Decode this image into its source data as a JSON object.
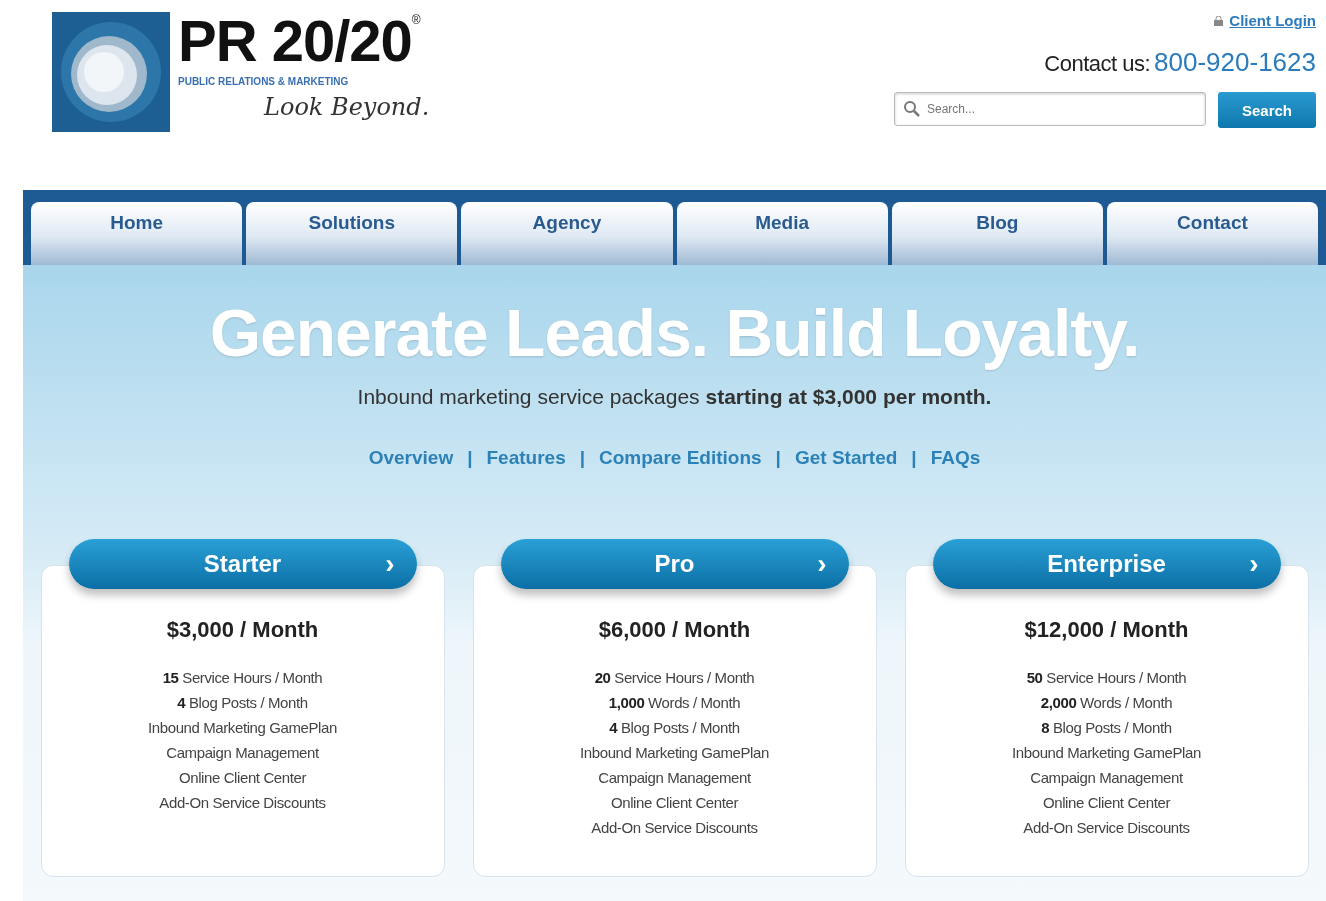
{
  "logo": {
    "name": "PR 20/20",
    "mark": "®",
    "subtitle": "PUBLIC RELATIONS & MARKETING",
    "tagline": "Look Beyond."
  },
  "header": {
    "login": "Client Login",
    "contact_label": "Contact us:",
    "phone": "800-920-1623",
    "search": {
      "placeholder": "Search..."
    },
    "search_button": "Search"
  },
  "nav": [
    {
      "label": "Home"
    },
    {
      "label": "Solutions"
    },
    {
      "label": "Agency"
    },
    {
      "label": "Media"
    },
    {
      "label": "Blog"
    },
    {
      "label": "Contact"
    }
  ],
  "hero": {
    "title": "Generate Leads. Build Loyalty.",
    "subtitle": "Inbound marketing service packages **starting at $3,000 per month.**",
    "links": [
      "Overview",
      "Features",
      "Compare Editions",
      "Get Started",
      "FAQs"
    ],
    "separator": "|"
  },
  "plans": [
    {
      "name": "Starter",
      "arrow": "›",
      "price": "$3,000 / Month",
      "features": [
        "**15** Service Hours / Month",
        "**4** Blog Posts / Month",
        "Inbound Marketing GamePlan",
        "Campaign Management",
        "Online Client Center",
        "Add-On Service Discounts"
      ]
    },
    {
      "name": "Pro",
      "arrow": "›",
      "price": "$6,000 / Month",
      "features": [
        "**20** Service Hours / Month",
        "**1,000** Words / Month",
        "**4** Blog Posts / Month",
        "Inbound Marketing GamePlan",
        "Campaign Management",
        "Online Client Center",
        "Add-On Service Discounts"
      ]
    },
    {
      "name": "Enterprise",
      "arrow": "›",
      "price": "$12,000 / Month",
      "features": [
        "**50** Service Hours / Month",
        "**2,000** Words / Month",
        "**8** Blog Posts / Month",
        "Inbound Marketing GamePlan",
        "Campaign Management",
        "Online Client Center",
        "Add-On Service Discounts"
      ]
    }
  ]
}
